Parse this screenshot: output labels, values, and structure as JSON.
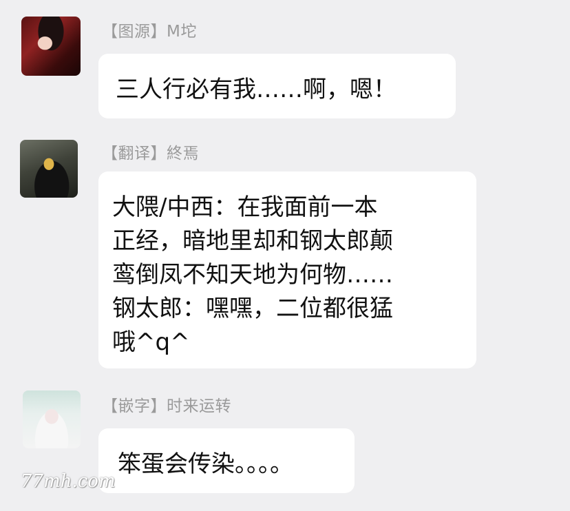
{
  "messages": [
    {
      "sender": "【图源】M坨",
      "lines": [
        "三人行必有我……啊，嗯！"
      ]
    },
    {
      "sender": "【翻译】終焉",
      "lines": [
        "大隈/中西：在我面前一本",
        "正经，暗地里却和钢太郎颠",
        "鸾倒凤不知天地为何物……",
        "钢太郎：嘿嘿，二位都很猛",
        "哦^q^"
      ]
    },
    {
      "sender": "【嵌字】时来运转",
      "lines": [
        "笨蛋会传染。。。。"
      ]
    }
  ],
  "watermark": "77mh.com"
}
